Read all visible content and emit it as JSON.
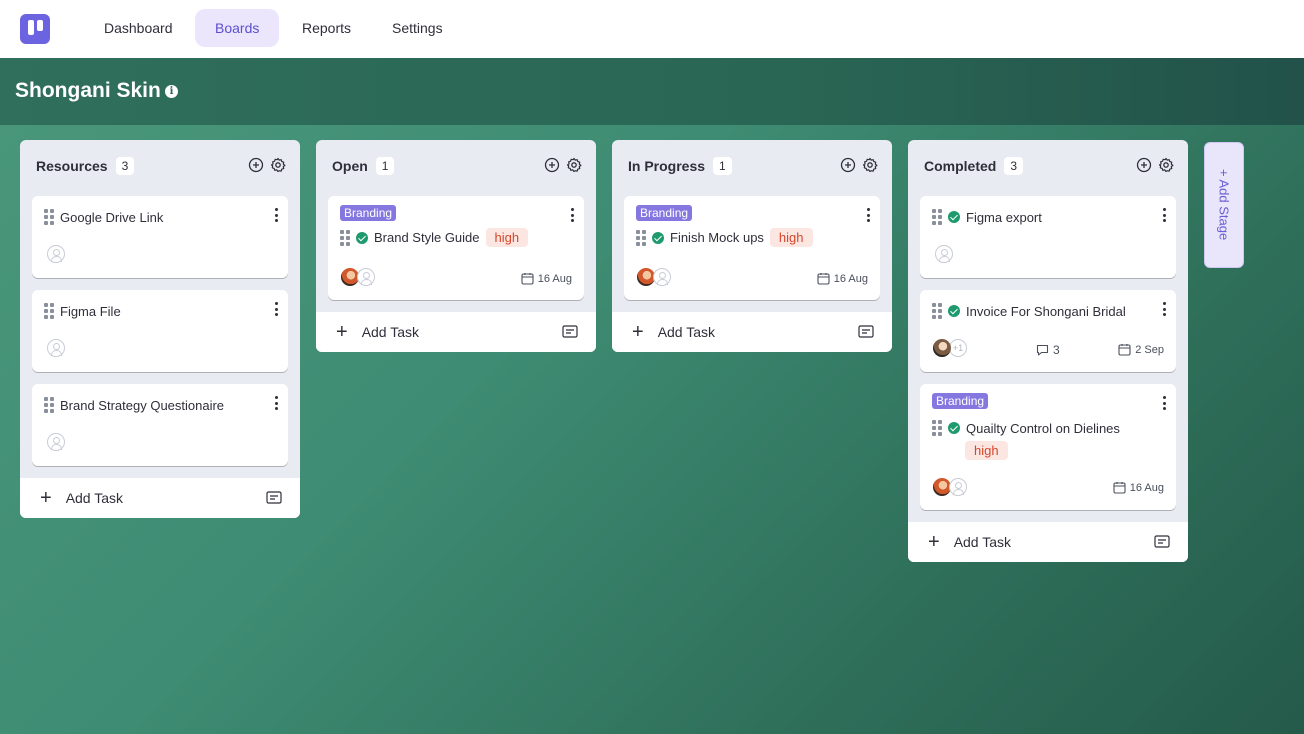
{
  "nav": {
    "logo_icon": "app-logo-icon",
    "links": [
      "Dashboard",
      "Boards",
      "Reports",
      "Settings"
    ],
    "active": "Boards"
  },
  "board": {
    "title": "Shongani Skin"
  },
  "columns": [
    {
      "name": "Resources",
      "count": "3",
      "add_task_label": "Add Task",
      "cards": [
        {
          "title": "Google Drive Link"
        },
        {
          "title": "Figma File"
        },
        {
          "title": "Brand Strategy Questionaire"
        }
      ]
    },
    {
      "name": "Open",
      "count": "1",
      "add_task_label": "Add Task",
      "cards": [
        {
          "tag": "Branding",
          "title": "Brand Style Guide",
          "priority": "high",
          "date": "16 Aug"
        }
      ]
    },
    {
      "name": "In Progress",
      "count": "1",
      "add_task_label": "Add Task",
      "cards": [
        {
          "tag": "Branding",
          "title": "Finish Mock ups",
          "priority": "high",
          "date": "16 Aug"
        }
      ]
    },
    {
      "name": "Completed",
      "count": "3",
      "add_task_label": "Add Task",
      "cards": [
        {
          "title": "Figma export"
        },
        {
          "title": "Invoice For Shongani Bridal",
          "extra_assignees": "+1",
          "comments": "3",
          "date": "2 Sep"
        },
        {
          "tag": "Branding",
          "title": "Quailty Control on Dielines",
          "priority": "high",
          "date": "16 Aug"
        }
      ]
    }
  ],
  "add_stage_label": "+ Add Stage",
  "colors": {
    "accent": "#6b63e0",
    "tag": "#8577e0",
    "priority_text": "#d6472b",
    "priority_bg": "#fbe6e2",
    "done_check": "#1f9a6e",
    "board_bg": "#3f8a70"
  }
}
